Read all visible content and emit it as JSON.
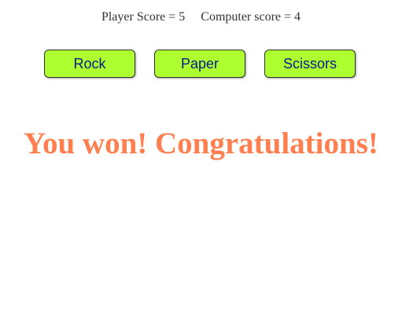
{
  "scoreboard": {
    "player_label": "Player Score = 5",
    "computer_label": "Computer score = 4"
  },
  "buttons": {
    "rock": "Rock",
    "paper": "Paper",
    "scissors": "Scissors"
  },
  "result": {
    "message": "You won! Congratulations!"
  },
  "colors": {
    "button_background": "#adff2f",
    "button_text": "#0a1a8a",
    "result_text": "#ff7f50"
  }
}
